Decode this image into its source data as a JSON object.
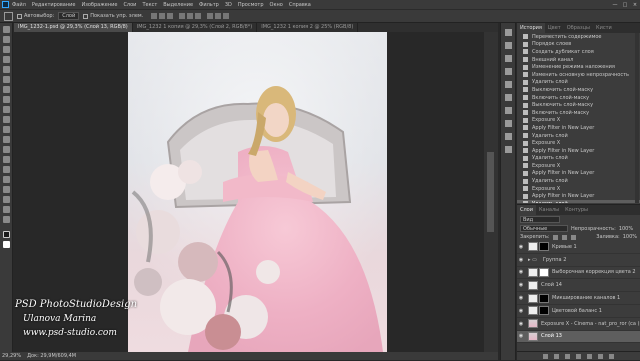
{
  "menubar": {
    "items": [
      "Файл",
      "Редактирование",
      "Изображение",
      "Слои",
      "Текст",
      "Выделение",
      "Фильтр",
      "3D",
      "Просмотр",
      "Окно",
      "Справка"
    ],
    "window_controls": [
      "—",
      "□",
      "×"
    ]
  },
  "options": {
    "autoselect_label": "Автовыбор:",
    "autoselect_value": "Слой",
    "show_controls_label": "Показать упр. элем."
  },
  "tabs": [
    "IMG_1232-1.psd @ 29,3% (Слой 13, RGB/8)",
    "IMG_1232 1 копия @ 29,3% (Слой 2, RGB/8*)",
    "IMG_1232 1 копия 2 @ 25% (RGB/8)"
  ],
  "status": {
    "zoom": "29,29%",
    "doc": "Док: 29,9M/609,4M"
  },
  "watermark": {
    "line1": "PSD PhotoStudioDesign",
    "line2": "Ulanova Marina",
    "line3": "www.psd-studio.com"
  },
  "history_panel": {
    "tabs": [
      "История",
      "Цвет",
      "Образцы",
      "Кисти"
    ],
    "items": [
      "Переместить содержимое",
      "Порядок слоев",
      "Создать дубликат слоя",
      "Внешний канал",
      "Изменение режима наложения",
      "Изменить основную непрозрачность",
      "Удалить слой",
      "Выключить слой-маску",
      "Включить слой-маску",
      "Выключить слой-маску",
      "Включить слой-маску",
      "Exposure X",
      "Apply Filter in New Layer",
      "Удалить слой",
      "Exposure X",
      "Apply Filter in New Layer",
      "Удалить слой",
      "Exposure X",
      "Apply Filter in New Layer",
      "Удалить слой",
      "Exposure X",
      "Apply Filter in New Layer",
      "Удалить слой"
    ],
    "active_index": 22
  },
  "layers_panel": {
    "tabs": [
      "Слои",
      "Каналы",
      "Контуры"
    ],
    "filter_label": "Вид",
    "blend_mode": "Обычные",
    "opacity_label": "Непрозрачность:",
    "opacity_value": "100%",
    "lock_label": "Закрепить:",
    "fill_label": "Заливка:",
    "fill_value": "100%",
    "layers": [
      {
        "name": "Кривые 1",
        "thumb": "white",
        "mask": "black",
        "visible": true
      },
      {
        "name": "Группа 2",
        "thumb": "group",
        "mask": "none",
        "visible": true
      },
      {
        "name": "Выборочная коррекция цвета 2",
        "thumb": "white",
        "mask": "white",
        "visible": true
      },
      {
        "name": "Слой 14",
        "thumb": "white",
        "mask": "none",
        "visible": true
      },
      {
        "name": "Микширование каналов 1",
        "thumb": "white",
        "mask": "black",
        "visible": true
      },
      {
        "name": "Цветовой баланс 1",
        "thumb": "white",
        "mask": "black",
        "visible": true
      },
      {
        "name": "Exposure X - Cinema - nat_pro_ror (ca (modified)",
        "thumb": "photo",
        "mask": "none",
        "visible": true
      },
      {
        "name": "Слой 13",
        "thumb": "photo",
        "mask": "none",
        "visible": true
      }
    ]
  }
}
